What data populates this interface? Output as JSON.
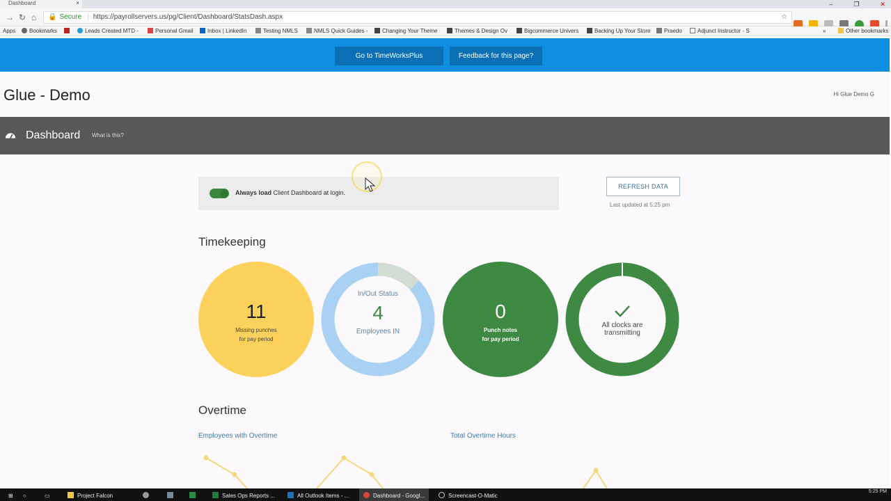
{
  "browser": {
    "tab_title": "Dashboard",
    "secure_label": "Secure",
    "url": "https://payrollservers.us/pg/Client/Dashboard/StatsDash.aspx",
    "bookmarks": [
      "Apps",
      "Bookmarks",
      "Leads Created MTD -",
      "Personal Gmail",
      "Inbox | LinkedIn",
      "Testing NMLS",
      "NMLS Quick Guides -",
      "Changing Your Theme",
      "Themes & Design Ov",
      "Bigcommerce Univers",
      "Backing Up Your Store",
      "Praedo",
      "Adjunct Instructor - S",
      "Other bookmarks"
    ]
  },
  "header": {
    "timeworks_button": "Go to TimeWorksPlus",
    "feedback_button": "Feedback for this page?",
    "app_title": "Glue - Demo",
    "greeting": "Hi Glue Demo G"
  },
  "dashboard": {
    "title": "Dashboard",
    "help_link": "What is this?"
  },
  "preference": {
    "bold": "Always load",
    "rest": " Client Dashboard at login."
  },
  "refresh": {
    "button": "REFRESH DATA",
    "updated": "Last updated at 5:25 pm"
  },
  "timekeeping": {
    "title": "Timekeeping",
    "missing": {
      "value": "11",
      "line1": "Missing punches",
      "line2": "for pay period",
      "color": "#fcd15c"
    },
    "inout": {
      "label": "In/Out Status",
      "value": "4",
      "caption": "Employees IN",
      "fraction_in": 0.87,
      "color_in": "#a9d1f4",
      "color_out": "#d3dcd3"
    },
    "punch_notes": {
      "value": "0",
      "line1": "Punch notes",
      "line2": "for pay period",
      "color": "#3e8a42"
    },
    "clocks": {
      "line1": "All clocks are",
      "line2": "transmitting",
      "color": "#3e8a42"
    }
  },
  "overtime": {
    "title": "Overtime",
    "employees_link": "Employees with Overtime",
    "hours_link": "Total Overtime Hours",
    "line_color": "#f5d87a"
  },
  "taskbar": {
    "items": [
      "Project Falcon",
      "Sales Ops Reports ...",
      "All Outlook Items - ...",
      "Dashboard - Googl...",
      "Screencast-O-Matic"
    ],
    "time": "5:25 PM"
  }
}
